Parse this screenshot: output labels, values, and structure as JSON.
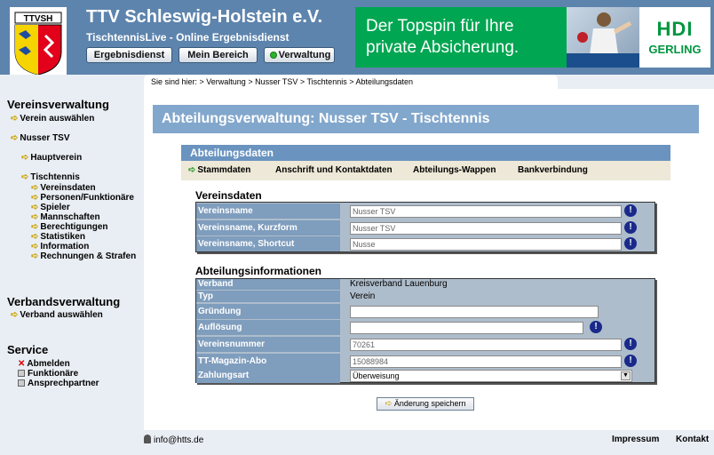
{
  "header": {
    "crest_text": "TTVSH",
    "title": "TTV Schleswig-Holstein e.V.",
    "subtitle": "TischtennisLive - Online Ergebnisdienst",
    "buttons": {
      "ergebnisdienst": "Ergebnisdienst",
      "mein_bereich": "Mein Bereich",
      "verwaltung": "Verwaltung"
    },
    "ad": {
      "text": "Der Topspin für Ihre\nprivate Absicherung.",
      "logo_top": "HDI",
      "logo_bottom": "GERLING"
    }
  },
  "sidebar": {
    "vereinsverwaltung": "Vereinsverwaltung",
    "verein_auswaehlen": "Verein auswählen",
    "verein_name": "Nusser TSV",
    "hauptverein": "Hauptverein",
    "tischtennis": "Tischtennis",
    "sub_items": [
      "Vereinsdaten",
      "Personen/Funktionäre",
      "Spieler",
      "Mannschaften",
      "Berechtigungen",
      "Statistiken",
      "Information",
      "Rechnungen & Strafen"
    ],
    "verbandsverwaltung": "Verbandsverwaltung",
    "verband_auswaehlen": "Verband auswählen",
    "service": "Service",
    "service_items": [
      "Abmelden",
      "Funktionäre",
      "Ansprechpartner"
    ]
  },
  "breadcrumb": "Sie sind hier: > Verwaltung > Nusser TSV > Tischtennis > Abteilungsdaten",
  "main": {
    "title": "Abteilungsverwaltung: Nusser TSV - Tischtennis",
    "tab_header": "Abteilungsdaten",
    "tabs": [
      "Stammdaten",
      "Anschrift und Kontaktdaten",
      "Abteilungs-Wappen",
      "Bankverbindung"
    ],
    "vereinsdaten": {
      "title": "Vereinsdaten",
      "rows": [
        {
          "label": "Vereinsname",
          "value": "Nusser TSV"
        },
        {
          "label": "Vereinsname, Kurzform",
          "value": "Nusser TSV"
        },
        {
          "label": "Vereinsname, Shortcut",
          "value": "Nusse"
        }
      ]
    },
    "abteilung": {
      "title": "Abteilungsinformationen",
      "verband_label": "Verband",
      "verband_value": "Kreisverband Lauenburg",
      "typ_label": "Typ",
      "typ_value": "Verein",
      "gruendung_label": "Gründung",
      "gruendung_value": "",
      "aufloesung_label": "Auflösung",
      "aufloesung_value": "",
      "vereinsnummer_label": "Vereinsnummer",
      "vereinsnummer_value": "70261",
      "ttmagazin_label": "TT-Magazin-Abo",
      "ttmagazin_value": "15088984",
      "zahlungsart_label": "Zahlungsart",
      "zahlungsart_value": "Überweisung"
    },
    "save_label": "Änderung speichern"
  },
  "footer": {
    "email": "info@htts.de",
    "impressum": "Impressum",
    "kontakt": "Kontakt"
  },
  "icons": {
    "info": "info-icon",
    "arrow": "arrow-right-icon",
    "close": "close-icon"
  },
  "colors": {
    "header": "#5d84ad",
    "title_bar": "#82a7cc",
    "label_bg": "#7f9dbd",
    "ad": "#00a651",
    "tab_bg": "#ede8d7"
  }
}
